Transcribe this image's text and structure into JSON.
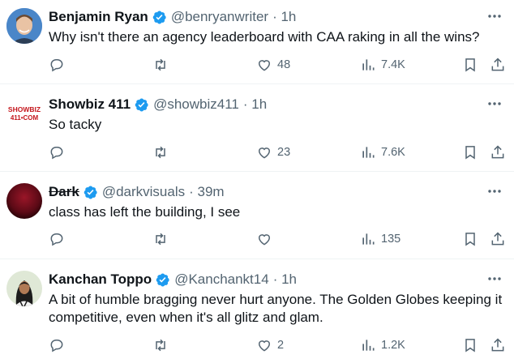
{
  "tweets": [
    {
      "name": "Benjamin Ryan",
      "handle": "@benryanwriter",
      "time": "· 1h",
      "lines": [
        "Why isn't there an agency leaderboard with CAA raking in all the wins?"
      ],
      "reply_count": "",
      "retweet_count": "",
      "like_count": "48",
      "view_count": "7.4K",
      "avatar_colors": [
        "#3a7bd5",
        "#e8c4a8"
      ]
    },
    {
      "name": "Showbiz 411",
      "handle": "@showbiz411",
      "time": "· 1h",
      "lines": [
        "So tacky"
      ],
      "reply_count": "",
      "retweet_count": "",
      "like_count": "23",
      "view_count": "7.6K",
      "avatar_logo_top": "SHOWBIZ",
      "avatar_logo_bottom": "411•COM"
    },
    {
      "name": "Dark",
      "handle": "@darkvisuals",
      "time": "· 39m",
      "lines": [
        "class has left the building, I see"
      ],
      "reply_count": "",
      "retweet_count": "",
      "like_count": "",
      "view_count": "135",
      "avatar_colors": [
        "#8b0f22",
        "#2a0308"
      ]
    },
    {
      "name": "Kanchan Toppo",
      "handle": "@Kanchankt14",
      "time": "· 1h",
      "lines": [
        "A bit of humble bragging never hurt anyone. The Golden Globes keeping it",
        "competitive, even when it's all glitz and glam."
      ],
      "reply_count": "",
      "retweet_count": "",
      "like_count": "2",
      "view_count": "1.2K",
      "avatar_colors": [
        "#dfe8d6",
        "#1c1c1c"
      ]
    }
  ],
  "icons": {
    "reply": "reply-icon",
    "retweet": "retweet-icon",
    "like": "heart-icon",
    "views": "views-icon",
    "bookmark": "bookmark-icon",
    "share": "share-icon",
    "more": "more-icon",
    "verified": "verified-badge-icon"
  },
  "colors": {
    "verified": "#1d9bf0",
    "secondary_text": "#536471",
    "divider": "#eff3f4"
  }
}
